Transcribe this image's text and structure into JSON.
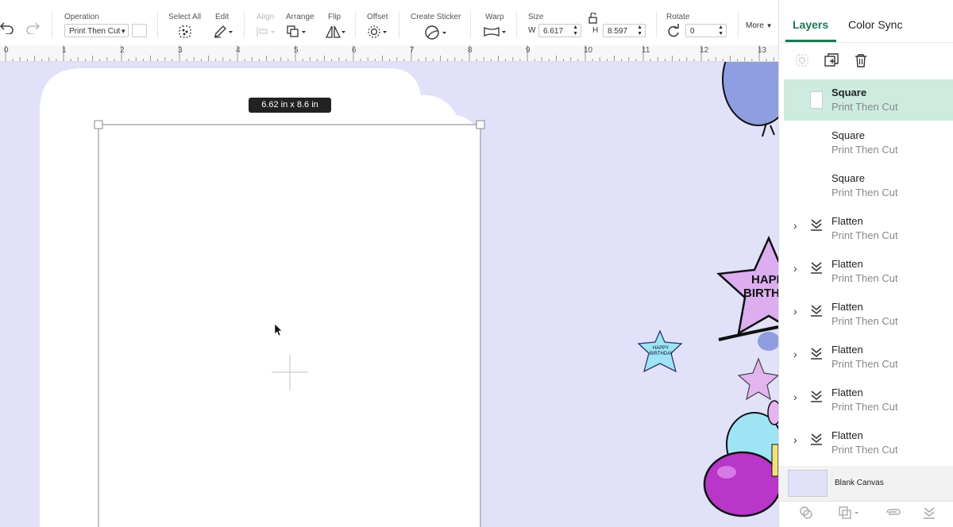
{
  "toolbar": {
    "operation_label": "Operation",
    "operation_value": "Print Then Cut",
    "select_all_label": "Select All",
    "edit_label": "Edit",
    "align_label": "Align",
    "arrange_label": "Arrange",
    "flip_label": "Flip",
    "offset_label": "Offset",
    "create_sticker_label": "Create Sticker",
    "warp_label": "Warp",
    "size_label": "Size",
    "w_label": "W",
    "w_value": "6.617",
    "h_label": "H",
    "h_value": "8.597",
    "rotate_label": "Rotate",
    "rotate_value": "0",
    "more_label": "More"
  },
  "ruler": {
    "marks": [
      "0",
      "1",
      "2",
      "3",
      "4",
      "5",
      "6",
      "7",
      "8",
      "9",
      "10",
      "11",
      "12",
      "13"
    ]
  },
  "canvas": {
    "dimension_tag": "6.62  in x 8.6  in",
    "sticker_text_small": [
      "HAPPY",
      "BIRTHDAY"
    ],
    "sticker_text_large": [
      "HAPP",
      "BIRTHD"
    ],
    "canvas_color": "#e1e1fa"
  },
  "panel": {
    "tabs": [
      "Layers",
      "Color Sync"
    ],
    "accent": "#1b7a52",
    "layers": [
      {
        "name": "Square",
        "sub": "Print Then Cut"
      },
      {
        "name": "Square",
        "sub": "Print Then Cut"
      },
      {
        "name": "Square",
        "sub": "Print Then Cut"
      },
      {
        "name": "Flatten",
        "sub": "Print Then Cut"
      },
      {
        "name": "Flatten",
        "sub": "Print Then Cut"
      },
      {
        "name": "Flatten",
        "sub": "Print Then Cut"
      },
      {
        "name": "Flatten",
        "sub": "Print Then Cut"
      },
      {
        "name": "Flatten",
        "sub": "Print Then Cut"
      },
      {
        "name": "Flatten",
        "sub": "Print Then Cut"
      }
    ],
    "blank_canvas_label": "Blank Canvas"
  }
}
